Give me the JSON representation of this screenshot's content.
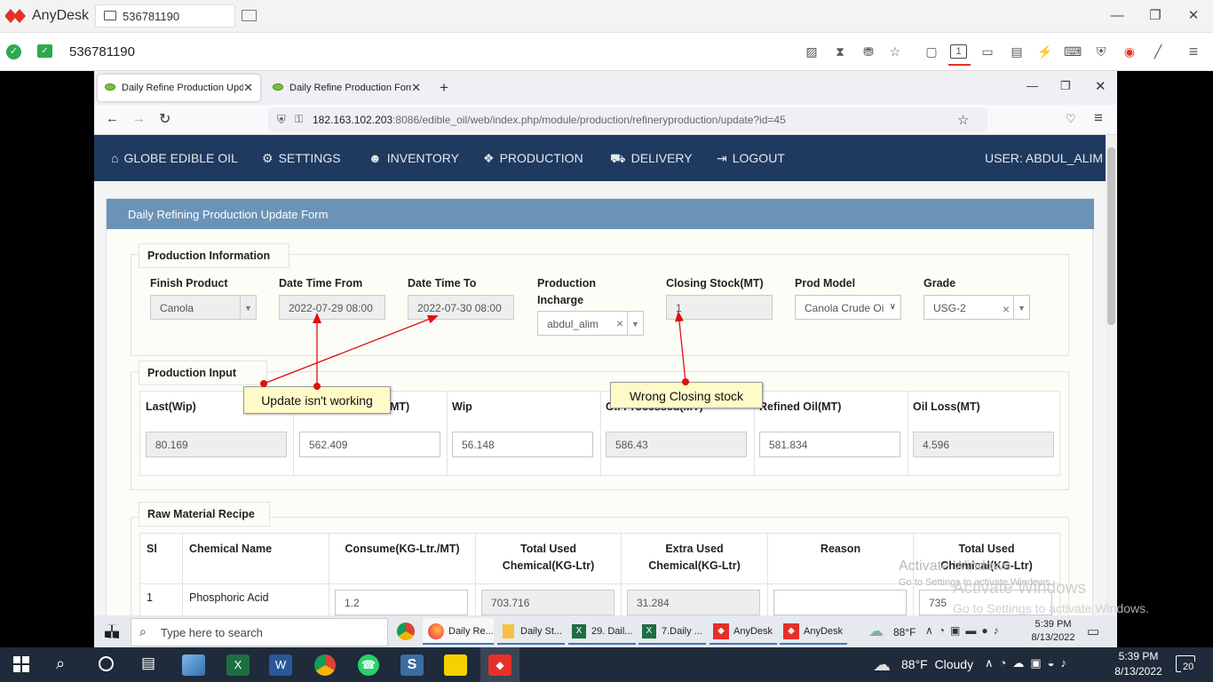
{
  "anydesk": {
    "app_name": "AnyDesk",
    "tab_label": "536781190",
    "address": "536781190"
  },
  "firefox": {
    "tabs": [
      {
        "title": "Daily Refine Production Update"
      },
      {
        "title": "Daily Refine Production Form"
      }
    ],
    "url_host": "182.163.102.203",
    "url_rest": ":8086/edible_oil/web/index.php/module/production/refineryproduction/update?id=45"
  },
  "nav": {
    "items": [
      {
        "icon": "home-icon",
        "glyph": "⌂",
        "label": "GLOBE EDIBLE OIL"
      },
      {
        "icon": "gears-icon",
        "glyph": "⚙",
        "label": "SETTINGS"
      },
      {
        "icon": "users-icon",
        "glyph": "☻",
        "label": "INVENTORY"
      },
      {
        "icon": "tags-icon",
        "glyph": "❖",
        "label": "PRODUCTION"
      },
      {
        "icon": "car-icon",
        "glyph": "⛟",
        "label": "DELIVERY"
      },
      {
        "icon": "logout-icon",
        "glyph": "⇥",
        "label": "LOGOUT"
      }
    ],
    "user": "USER: ABDUL_ALIM"
  },
  "form": {
    "title": "Daily Refining Production Update Form",
    "production_info": {
      "legend": "Production Information",
      "finish_product": {
        "label": "Finish Product",
        "value": "Canola"
      },
      "date_from": {
        "label": "Date Time From",
        "value": "2022-07-29 08:00"
      },
      "date_to": {
        "label": "Date Time To",
        "value": "2022-07-30 08:00"
      },
      "incharge": {
        "label_1": "Production",
        "label_2": "Incharge",
        "value": "abdul_alim"
      },
      "closing_stock": {
        "label": "Closing Stock(MT)",
        "value": "1"
      },
      "prod_model": {
        "label": "Prod Model",
        "value": "Canola Crude Oi"
      },
      "grade": {
        "label": "Grade",
        "value": "USG-2"
      }
    },
    "production_input": {
      "legend": "Production Input",
      "columns": [
        {
          "label": "Last(Wip)",
          "value": "80.169"
        },
        {
          "label": "MT)",
          "value": "562.409"
        },
        {
          "label": "Wip",
          "value": "56.148"
        },
        {
          "label": "Oil Processed(MT)",
          "value": "586.43"
        },
        {
          "label": "Refined Oil(MT)",
          "value": "581.834"
        },
        {
          "label": "Oil Loss(MT)",
          "value": "4.596"
        }
      ]
    },
    "raw_material": {
      "legend": "Raw Material Recipe",
      "headers": {
        "sl": "Sl",
        "chemical": "Chemical Name",
        "consume": "Consume(KG-Ltr./MT)",
        "total_1": "Total Used",
        "total_2": "Chemical(KG-Ltr)",
        "extra_1": "Extra Used",
        "extra_2": "Chemical(KG-Ltr)",
        "reason": "Reason",
        "total2_1": "Total Used",
        "total2_2": "Chemical(KG-Ltr)"
      },
      "rows": [
        {
          "sl": "1",
          "chemical": "Phosphoric Acid",
          "consume": "1.2",
          "total": "703.716",
          "extra": "31.284",
          "reason": "",
          "total2": "735"
        }
      ]
    }
  },
  "annotations": {
    "update_note": "Update isn't working",
    "stock_note": "Wrong Closing stock"
  },
  "watermark": {
    "title": "Activate Windows",
    "sub": "Go to Settings to activate Windows."
  },
  "remote_taskbar": {
    "search": "Type here to search",
    "apps": [
      "Daily Re...",
      "Daily St...",
      "29. Dail...",
      "7.Daily ...",
      "AnyDesk",
      "AnyDesk"
    ],
    "weather": "88°F",
    "time": "5:39 PM",
    "date": "8/13/2022"
  },
  "local_taskbar": {
    "weather": "88°F  Cloudy",
    "time": "5:39 PM",
    "date": "8/13/2022",
    "notif_count": "20"
  },
  "colors": {
    "nav_bg": "#1f3a5f",
    "panel_header": "#6b93b7",
    "anydesk_red": "#e63027",
    "callout_bg": "#fffbc8",
    "arrow": "#e01010"
  }
}
